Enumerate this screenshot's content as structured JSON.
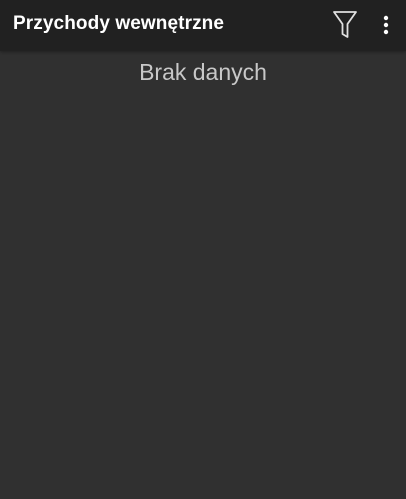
{
  "toolbar": {
    "title": "Przychody wewnętrzne",
    "filter_icon": "filter-icon",
    "menu_icon": "more-vertical-icon"
  },
  "main": {
    "empty_message": "Brak danych"
  },
  "colors": {
    "toolbar_bg": "#212121",
    "page_bg": "#303030",
    "title_text": "#ffffff",
    "empty_text": "#c8c8c8"
  }
}
